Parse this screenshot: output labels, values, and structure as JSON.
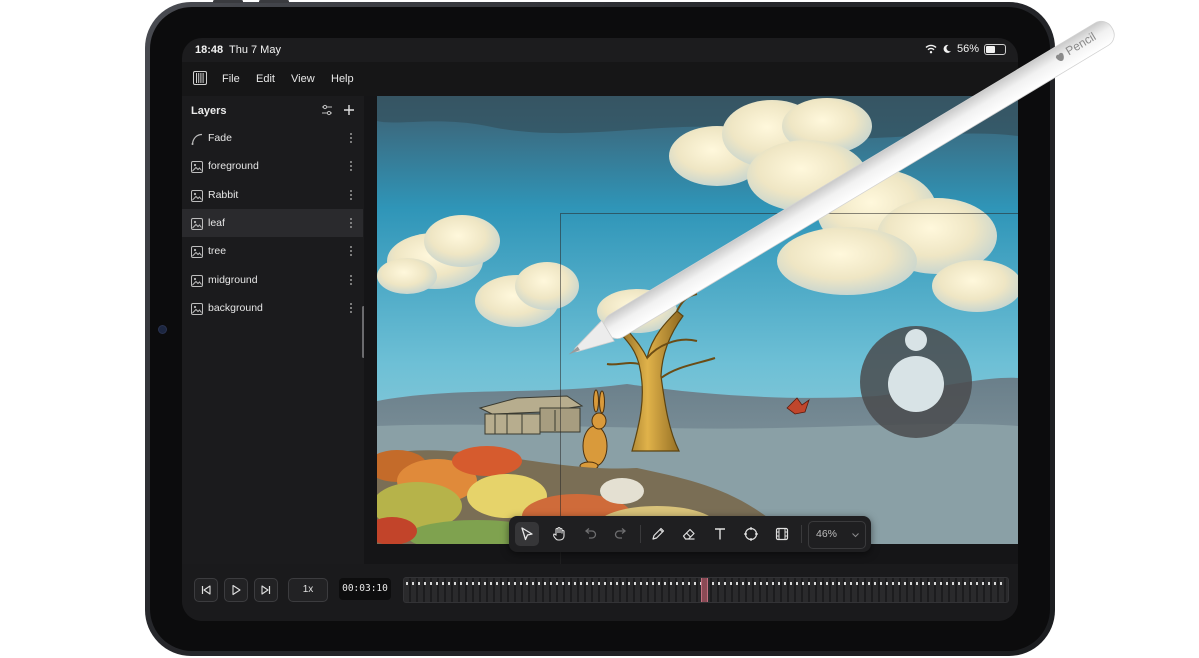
{
  "status": {
    "time": "18:48",
    "date": "Thu 7 May",
    "battery_percent": "56%",
    "battery_level": 0.56
  },
  "menu": [
    "File",
    "Edit",
    "View",
    "Help"
  ],
  "layers_panel": {
    "title": "Layers",
    "items": [
      {
        "label": "Fade",
        "icon": "curve-icon",
        "selected": false
      },
      {
        "label": "foreground",
        "icon": "image-icon",
        "selected": false
      },
      {
        "label": "Rabbit",
        "icon": "image-icon",
        "selected": false
      },
      {
        "label": "leaf",
        "icon": "image-icon",
        "selected": true
      },
      {
        "label": "tree",
        "icon": "image-icon",
        "selected": false
      },
      {
        "label": "midground",
        "icon": "image-icon",
        "selected": false
      },
      {
        "label": "background",
        "icon": "image-icon",
        "selected": false
      }
    ]
  },
  "toolbar": {
    "tools": [
      "select-tool",
      "hand-tool",
      "undo",
      "redo",
      "brush-tool",
      "eraser-tool",
      "text-tool",
      "target-tool",
      "film-tool"
    ],
    "active_tool": "select-tool",
    "zoom": "46%"
  },
  "timeline": {
    "speed": "1x",
    "time": "00:03:10",
    "playhead_fraction": 0.495
  },
  "pencil": {
    "brand": "Pencil"
  },
  "colors": {
    "accent": "#8a4a55",
    "panel": "#1b1b1d",
    "menubar": "#161617"
  }
}
